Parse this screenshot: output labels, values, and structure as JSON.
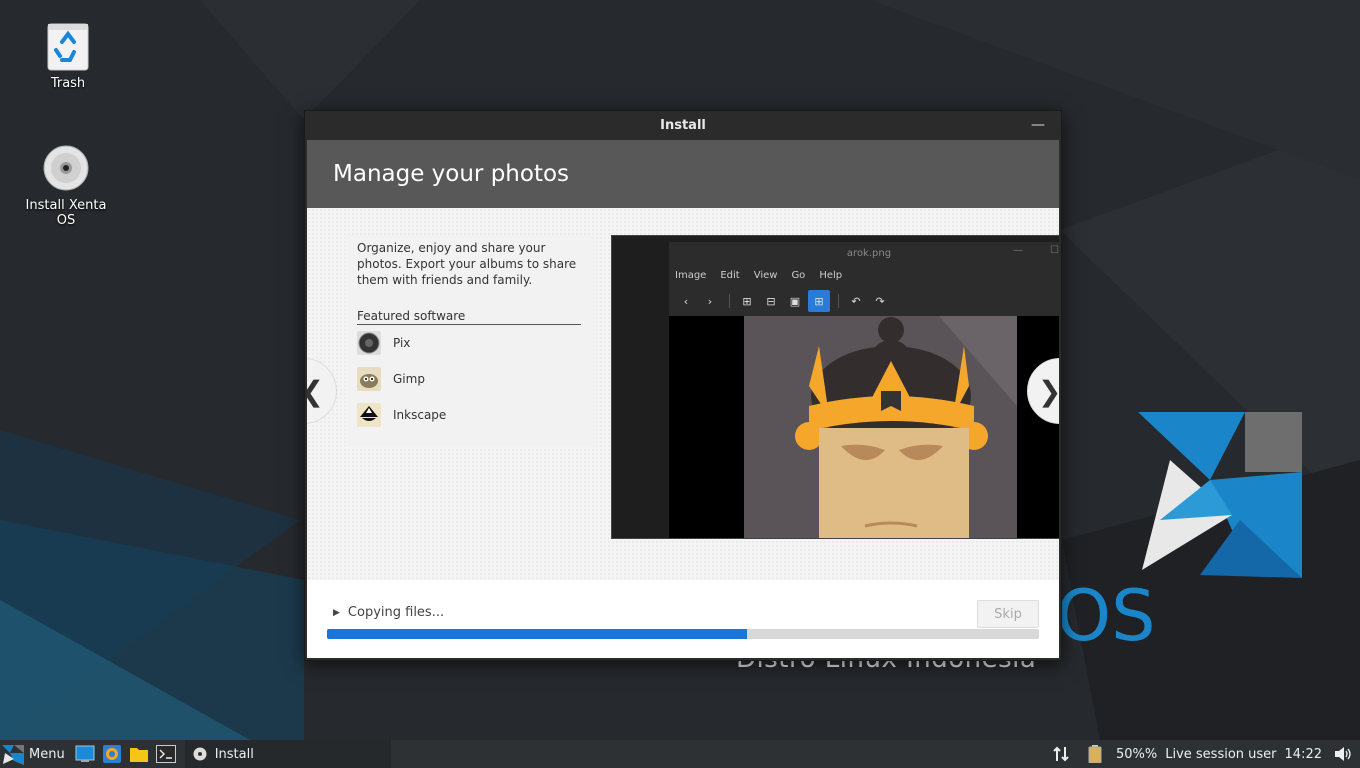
{
  "desktop": {
    "icons": [
      {
        "label": "Trash"
      },
      {
        "label": "Install Xenta OS"
      }
    ],
    "wallpaper_slogan": "Distro Linux Indonesia",
    "wallpaper_logo_text": "OS"
  },
  "window": {
    "title": "Install",
    "minimize_glyph": "—",
    "slide": {
      "title": "Manage your photos",
      "description": "Organize, enjoy and share your photos. Export your albums to share them with friends and family.",
      "featured_title": "Featured software",
      "apps": [
        {
          "name": "Pix"
        },
        {
          "name": "Gimp"
        },
        {
          "name": "Inkscape"
        }
      ],
      "prev_glyph": "❮",
      "next_glyph": "❯",
      "screenshot": {
        "window_title": "arok.png",
        "menu": [
          "Image",
          "Edit",
          "View",
          "Go",
          "Help"
        ]
      }
    },
    "progress": {
      "status": "Copying files...",
      "skip_label": "Skip",
      "percent": 59
    }
  },
  "taskbar": {
    "menu_label": "Menu",
    "task_label": "Install",
    "battery": "50%%",
    "user": "Live session user",
    "clock": "14:22"
  },
  "colors": {
    "accent": "#1877d6",
    "header_bg": "#585858",
    "taskbar_bg": "#2e3134"
  }
}
